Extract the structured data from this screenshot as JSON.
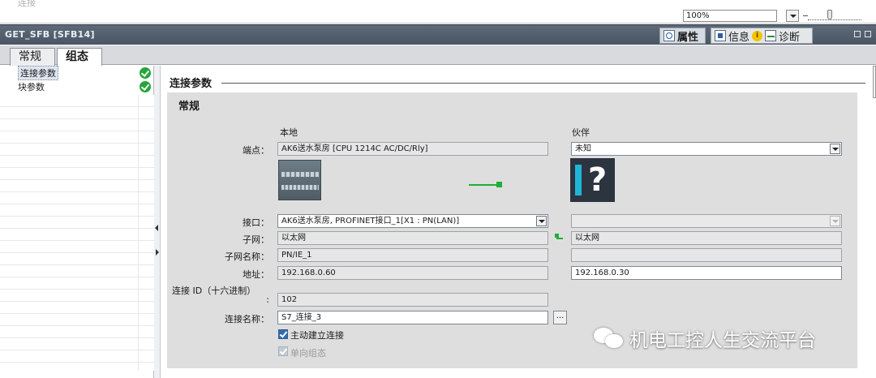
{
  "top_bar": {
    "cut_label": "连接",
    "zoom_value": "100%"
  },
  "panel": {
    "title": "GET_SFB [SFB14]",
    "tabs": [
      {
        "label": "属性",
        "icon": "properties-icon"
      },
      {
        "label": "信息",
        "icon": "info-icon"
      },
      {
        "label": "诊断",
        "icon": "diagnostics-icon"
      }
    ]
  },
  "subtabs": [
    {
      "label": "常规"
    },
    {
      "label": "组态"
    }
  ],
  "nav": {
    "items": [
      {
        "label": "连接参数",
        "status": "ok"
      },
      {
        "label": "块参数",
        "status": "ok"
      }
    ]
  },
  "section": {
    "title": "连接参数",
    "group_title": "常规",
    "local_header": "本地",
    "partner_header": "伙伴",
    "labels": {
      "endpoint": "端点：",
      "interface": "接口：",
      "subnet": "子网：",
      "subnet_name": "子网名称：",
      "address": "地址：",
      "conn_id_line1": "连接 ID（十六进制）",
      "conn_id_line2": ":",
      "conn_name": "连接名称："
    },
    "local": {
      "endpoint": "AK6送水泵房 [CPU 1214C AC/DC/Rly]",
      "interface": "AK6送水泵房, PROFINET接口_1[X1 : PN(LAN)]",
      "subnet": "以太网",
      "subnet_name": "PN/IE_1",
      "address": "192.168.0.60",
      "conn_id": "102",
      "conn_name": "S7_连接_3"
    },
    "partner": {
      "endpoint": "未知",
      "interface": "",
      "subnet": "以太网",
      "subnet_name": "",
      "address": "192.168.0.30"
    },
    "browse_label": "...",
    "active_conn_label": "主动建立连接",
    "active_conn_checked": true,
    "one_way_label": "单向组态",
    "one_way_checked": true
  },
  "watermark": {
    "text": "机电工控人生交流平台"
  }
}
